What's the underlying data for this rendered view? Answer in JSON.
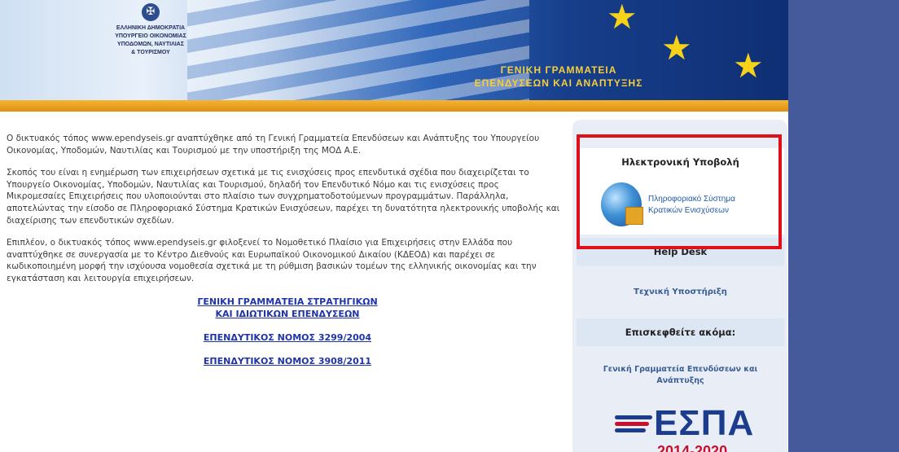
{
  "header": {
    "logo_lines": [
      "ΕΛΛΗΝΙΚΗ ΔΗΜΟΚΡΑΤΙΑ",
      "ΥΠΟΥΡΓΕΙΟ ΟΙΚΟΝΟΜΙΑΣ",
      "ΥΠΟΔΟΜΩΝ, ΝΑΥΤΙΛΙΑΣ",
      "& ΤΟΥΡΙΣΜΟΥ"
    ],
    "title_lines": [
      "ΓΕΝΙΚΗ ΓΡΑΜΜΑΤΕΙΑ",
      "ΕΠΕΝΔΥΣΕΩΝ ΚΑΙ ΑΝΑΠΤΥΞΗΣ"
    ],
    "colors": {
      "accent_orange": "#e9a21f",
      "title_yellow": "#f5cf3d",
      "side_blue": "#445a9b"
    }
  },
  "main": {
    "paragraphs": [
      "Ο δικτυακός τόπος www.ependyseis.gr αναπτύχθηκε από τη Γενική Γραμματεία Επενδύσεων και Ανάπτυξης του Υπουργείου Οικονομίας, Υποδομών, Ναυτιλίας και Τουρισμού με την υποστήριξη της ΜΟΔ Α.Ε.",
      "Σκοπός του είναι η ενημέρωση των επιχειρήσεων σχετικά με τις ενισχύσεις προς επενδυτικά σχέδια που διαχειρίζεται το Υπουργείο Οικονομίας, Υποδομών, Ναυτιλίας και Τουρισμού, δηλαδή τον Επενδυτικό Νόμο και τις ενισχύσεις προς Μικρομεσαίες Επιχειρήσεις που υλοποιούνται στο πλαίσιο των συγχρηματοδοτούμενων προγραμμάτων. Παράλληλα, αποτελώντας την είσοδο σε Πληροφοριακό Σύστημα Κρατικών Ενισχύσεων, παρέχει τη δυνατότητα ηλεκτρονικής υποβολής και διαχείρισης των επενδυτικών σχεδίων.",
      "Επιπλέον, ο δικτυακός τόπος www.ependyseis.gr φιλοξενεί το Νομοθετικό Πλαίσιο για Επιχειρήσεις στην Ελλάδα που αναπτύχθηκε σε συνεργασία με το Κέντρο Διεθνούς και Ευρωπαϊκού Οικονομικού Δικαίου (ΚΔΕΟΔ) και παρέχει σε κωδικοποιημένη μορφή την ισχύουσα νομοθεσία σχετικά με τη ρύθμιση βασικών τομέων της ελληνικής οικονομίας και την εγκατάσταση και λειτουργία επιχειρήσεων."
    ],
    "links": {
      "gg_line1": "ΓΕΝΙΚΗ ΓΡΑΜΜΑΤΕΙΑ ΣΤΡΑΤΗΓΙΚΩΝ",
      "gg_line2": "ΚΑΙ ΙΔΙΩΤΙΚΩΝ ΕΠΕΝΔΥΣΕΩΝ",
      "law_3299": "ΕΠΕΝΔΥΤΙΚΟΣ ΝΟΜΟΣ 3299/2004",
      "law_next": "ΕΠΕΝΔΥΤΙΚΟΣ ΝΟΜΟΣ 3908/2011"
    }
  },
  "sidebar": {
    "electronic_submission_title": "Ηλεκτρονική Υποβολή",
    "info_system_line1": "Πληροφοριακό Σύστημα",
    "info_system_line2": "Κρατικών Ενισχύσεων",
    "help_desk_title": "Help Desk",
    "tech_support": "Τεχνική Υποστήριξη",
    "visit_also_title": "Επισκεφθείτε ακόμα:",
    "gen_secretariat": "Γενική Γραμματεία Επενδύσεων και Ανάπτυξης",
    "espa_logo": "ΕΣΠΑ",
    "espa_years": "2014-2020"
  }
}
